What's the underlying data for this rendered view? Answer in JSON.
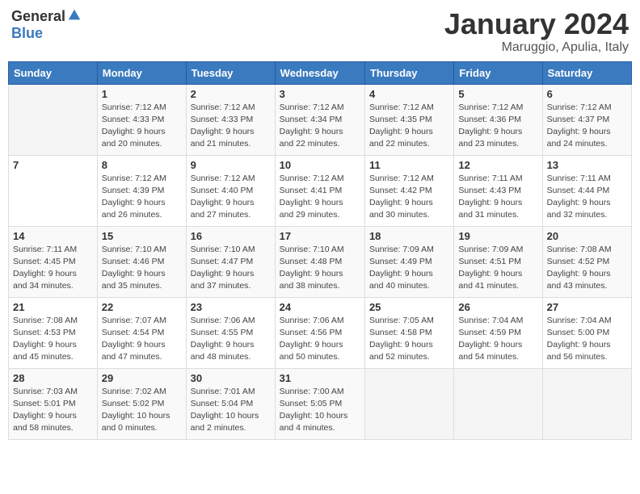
{
  "header": {
    "logo_general": "General",
    "logo_blue": "Blue",
    "month": "January 2024",
    "location": "Maruggio, Apulia, Italy"
  },
  "weekdays": [
    "Sunday",
    "Monday",
    "Tuesday",
    "Wednesday",
    "Thursday",
    "Friday",
    "Saturday"
  ],
  "weeks": [
    [
      {
        "day": "",
        "info": ""
      },
      {
        "day": "1",
        "info": "Sunrise: 7:12 AM\nSunset: 4:33 PM\nDaylight: 9 hours\nand 20 minutes."
      },
      {
        "day": "2",
        "info": "Sunrise: 7:12 AM\nSunset: 4:33 PM\nDaylight: 9 hours\nand 21 minutes."
      },
      {
        "day": "3",
        "info": "Sunrise: 7:12 AM\nSunset: 4:34 PM\nDaylight: 9 hours\nand 22 minutes."
      },
      {
        "day": "4",
        "info": "Sunrise: 7:12 AM\nSunset: 4:35 PM\nDaylight: 9 hours\nand 22 minutes."
      },
      {
        "day": "5",
        "info": "Sunrise: 7:12 AM\nSunset: 4:36 PM\nDaylight: 9 hours\nand 23 minutes."
      },
      {
        "day": "6",
        "info": "Sunrise: 7:12 AM\nSunset: 4:37 PM\nDaylight: 9 hours\nand 24 minutes."
      }
    ],
    [
      {
        "day": "7",
        "info": ""
      },
      {
        "day": "8",
        "info": "Sunrise: 7:12 AM\nSunset: 4:39 PM\nDaylight: 9 hours\nand 26 minutes."
      },
      {
        "day": "9",
        "info": "Sunrise: 7:12 AM\nSunset: 4:40 PM\nDaylight: 9 hours\nand 27 minutes."
      },
      {
        "day": "10",
        "info": "Sunrise: 7:12 AM\nSunset: 4:41 PM\nDaylight: 9 hours\nand 29 minutes."
      },
      {
        "day": "11",
        "info": "Sunrise: 7:12 AM\nSunset: 4:42 PM\nDaylight: 9 hours\nand 30 minutes."
      },
      {
        "day": "12",
        "info": "Sunrise: 7:11 AM\nSunset: 4:43 PM\nDaylight: 9 hours\nand 31 minutes."
      },
      {
        "day": "13",
        "info": "Sunrise: 7:11 AM\nSunset: 4:44 PM\nDaylight: 9 hours\nand 32 minutes."
      }
    ],
    [
      {
        "day": "14",
        "info": "Sunrise: 7:11 AM\nSunset: 4:45 PM\nDaylight: 9 hours\nand 34 minutes."
      },
      {
        "day": "15",
        "info": "Sunrise: 7:10 AM\nSunset: 4:46 PM\nDaylight: 9 hours\nand 35 minutes."
      },
      {
        "day": "16",
        "info": "Sunrise: 7:10 AM\nSunset: 4:47 PM\nDaylight: 9 hours\nand 37 minutes."
      },
      {
        "day": "17",
        "info": "Sunrise: 7:10 AM\nSunset: 4:48 PM\nDaylight: 9 hours\nand 38 minutes."
      },
      {
        "day": "18",
        "info": "Sunrise: 7:09 AM\nSunset: 4:49 PM\nDaylight: 9 hours\nand 40 minutes."
      },
      {
        "day": "19",
        "info": "Sunrise: 7:09 AM\nSunset: 4:51 PM\nDaylight: 9 hours\nand 41 minutes."
      },
      {
        "day": "20",
        "info": "Sunrise: 7:08 AM\nSunset: 4:52 PM\nDaylight: 9 hours\nand 43 minutes."
      }
    ],
    [
      {
        "day": "21",
        "info": "Sunrise: 7:08 AM\nSunset: 4:53 PM\nDaylight: 9 hours\nand 45 minutes."
      },
      {
        "day": "22",
        "info": "Sunrise: 7:07 AM\nSunset: 4:54 PM\nDaylight: 9 hours\nand 47 minutes."
      },
      {
        "day": "23",
        "info": "Sunrise: 7:06 AM\nSunset: 4:55 PM\nDaylight: 9 hours\nand 48 minutes."
      },
      {
        "day": "24",
        "info": "Sunrise: 7:06 AM\nSunset: 4:56 PM\nDaylight: 9 hours\nand 50 minutes."
      },
      {
        "day": "25",
        "info": "Sunrise: 7:05 AM\nSunset: 4:58 PM\nDaylight: 9 hours\nand 52 minutes."
      },
      {
        "day": "26",
        "info": "Sunrise: 7:04 AM\nSunset: 4:59 PM\nDaylight: 9 hours\nand 54 minutes."
      },
      {
        "day": "27",
        "info": "Sunrise: 7:04 AM\nSunset: 5:00 PM\nDaylight: 9 hours\nand 56 minutes."
      }
    ],
    [
      {
        "day": "28",
        "info": "Sunrise: 7:03 AM\nSunset: 5:01 PM\nDaylight: 9 hours\nand 58 minutes."
      },
      {
        "day": "29",
        "info": "Sunrise: 7:02 AM\nSunset: 5:02 PM\nDaylight: 10 hours\nand 0 minutes."
      },
      {
        "day": "30",
        "info": "Sunrise: 7:01 AM\nSunset: 5:04 PM\nDaylight: 10 hours\nand 2 minutes."
      },
      {
        "day": "31",
        "info": "Sunrise: 7:00 AM\nSunset: 5:05 PM\nDaylight: 10 hours\nand 4 minutes."
      },
      {
        "day": "",
        "info": ""
      },
      {
        "day": "",
        "info": ""
      },
      {
        "day": "",
        "info": ""
      }
    ]
  ]
}
